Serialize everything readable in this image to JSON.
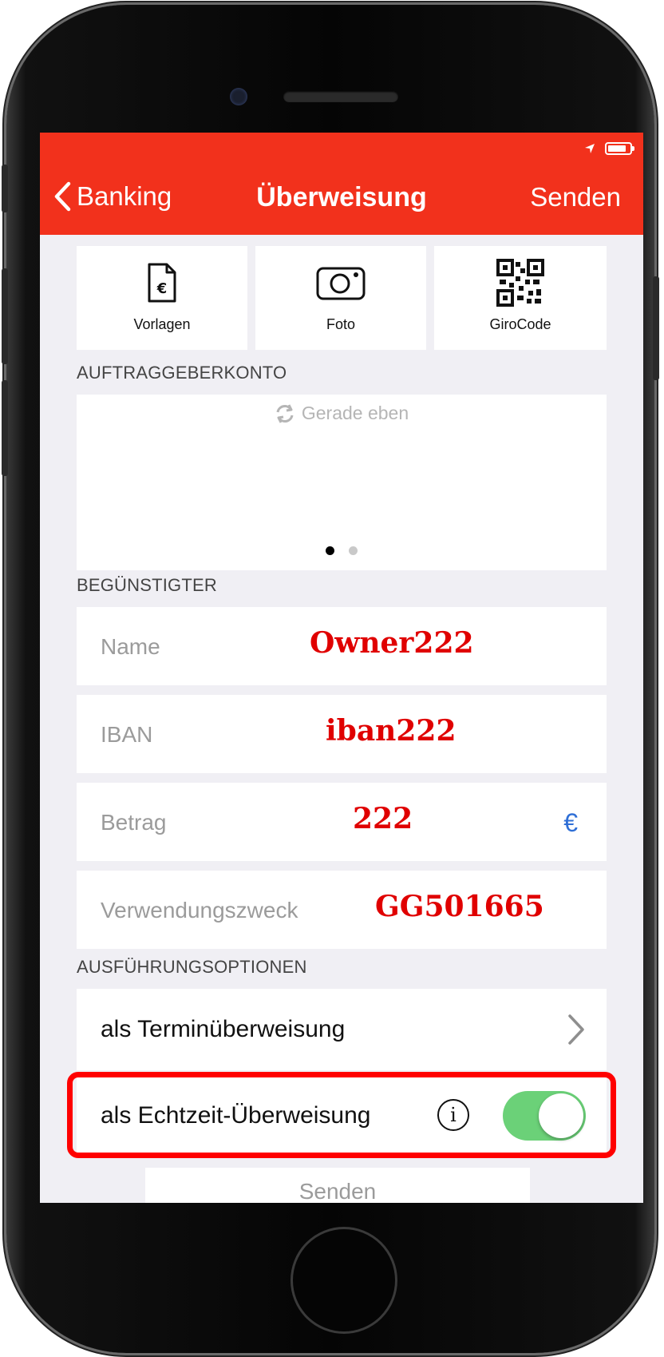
{
  "nav": {
    "back_label": "Banking",
    "title": "Überweisung",
    "send_label": "Senden"
  },
  "tiles": [
    {
      "label": "Vorlagen",
      "icon": "document-euro-icon"
    },
    {
      "label": "Foto",
      "icon": "camera-icon"
    },
    {
      "label": "GiroCode",
      "icon": "qr-code-icon"
    }
  ],
  "sections": {
    "account": "AUFTRAGGEBERKONTO",
    "beneficiary": "BEGÜNSTIGTER",
    "options": "AUSFÜHRUNGSOPTIONEN"
  },
  "account": {
    "refresh_text": "Gerade eben",
    "page_count": 2,
    "active_page": 1
  },
  "fields": {
    "name": {
      "placeholder": "Name",
      "value": "Owner222"
    },
    "iban": {
      "placeholder": "IBAN",
      "value": "iban222"
    },
    "amount": {
      "placeholder": "Betrag",
      "value": "222",
      "currency": "€"
    },
    "purpose": {
      "placeholder": "Verwendungszweck",
      "value": "GG501665"
    }
  },
  "options": {
    "scheduled": "als Terminüberweisung",
    "instant": "als Echtzeit-Überweisung",
    "instant_enabled": true,
    "info_glyph": "i"
  },
  "bottom_button": "Senden",
  "colors": {
    "brand": "#f2311c",
    "toggle_on": "#6bd178",
    "highlight": "#ff0000",
    "value_text": "#e00000",
    "currency": "#2f6fd6"
  }
}
